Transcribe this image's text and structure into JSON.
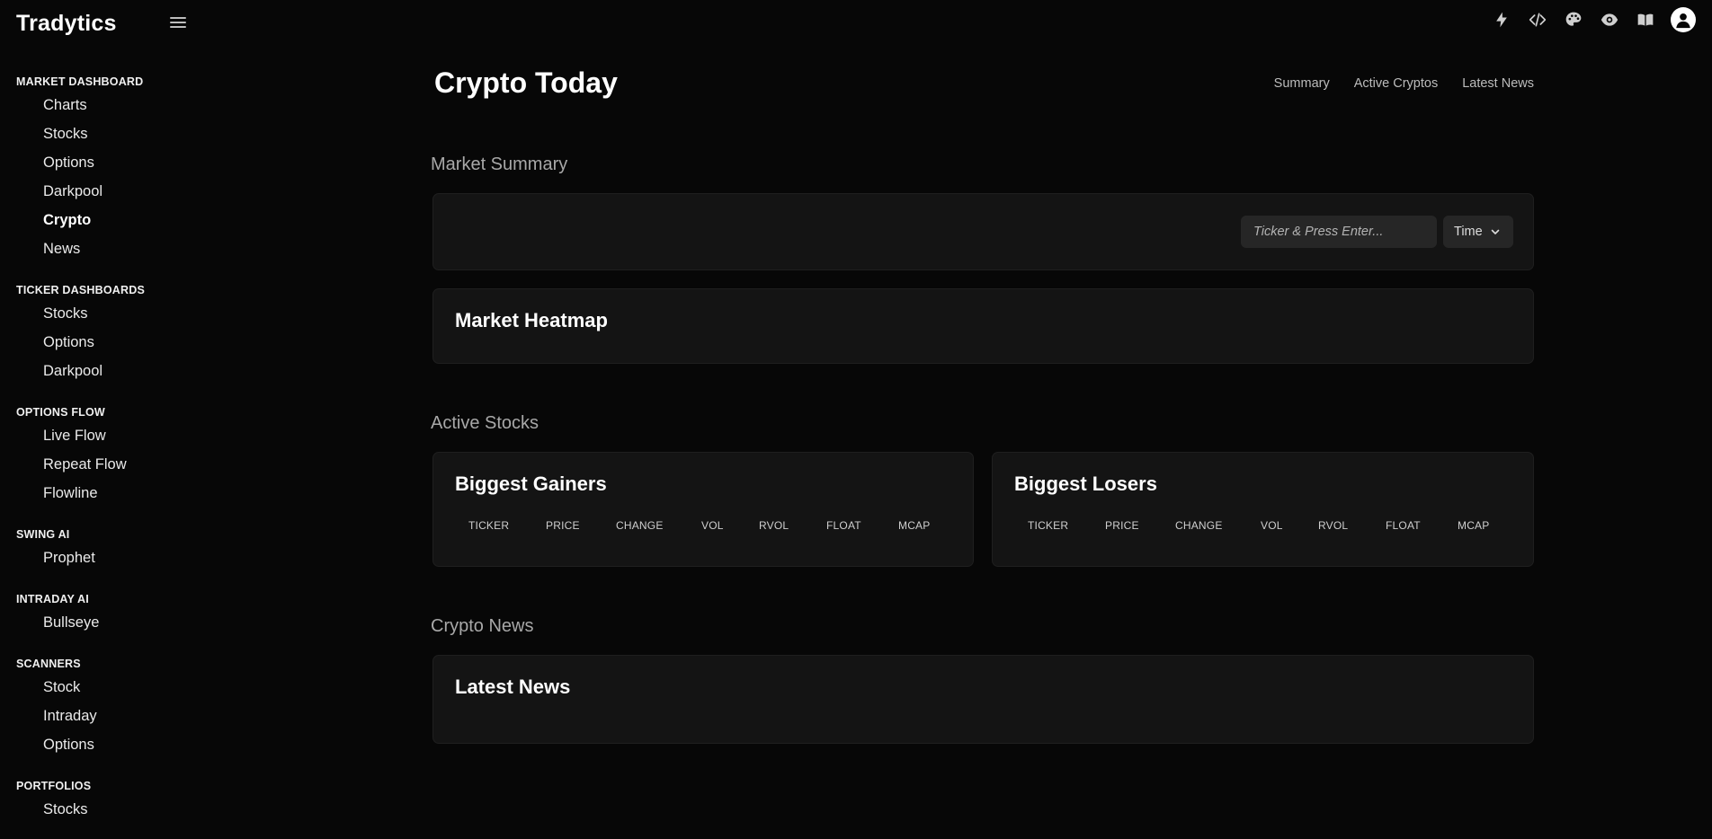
{
  "app": {
    "brand": "Tradytics"
  },
  "topbar": {
    "icons": [
      "lightning-icon",
      "code-icon",
      "palette-icon",
      "eye-icon",
      "book-icon",
      "user-icon"
    ]
  },
  "sidebar": {
    "sections": [
      {
        "title": "Market Dashboard",
        "items": [
          "Charts",
          "Stocks",
          "Options",
          "Darkpool",
          "Crypto",
          "News"
        ]
      },
      {
        "title": "Ticker Dashboards",
        "items": [
          "Stocks",
          "Options",
          "Darkpool"
        ]
      },
      {
        "title": "Options Flow",
        "items": [
          "Live Flow",
          "Repeat Flow",
          "Flowline"
        ]
      },
      {
        "title": "Swing AI",
        "items": [
          "Prophet"
        ]
      },
      {
        "title": "Intraday AI",
        "items": [
          "Bullseye"
        ]
      },
      {
        "title": "Scanners",
        "items": [
          "Stock",
          "Intraday",
          "Options"
        ]
      },
      {
        "title": "Portfolios",
        "items": [
          "Stocks"
        ]
      }
    ],
    "active": "Crypto"
  },
  "page": {
    "title": "Crypto Today",
    "nav": [
      "Summary",
      "Active Cryptos",
      "Latest News"
    ]
  },
  "market_summary": {
    "heading": "Market Summary",
    "search_placeholder": "Ticker & Press Enter...",
    "time_label": "Time",
    "heatmap_title": "Market Heatmap"
  },
  "active_stocks": {
    "heading": "Active Stocks",
    "gainers_title": "Biggest Gainers",
    "losers_title": "Biggest Losers",
    "columns": [
      "TICKER",
      "PRICE",
      "CHANGE",
      "VOL",
      "RVOL",
      "FLOAT",
      "MCAP"
    ]
  },
  "crypto_news": {
    "heading": "Crypto News",
    "latest_title": "Latest News"
  }
}
